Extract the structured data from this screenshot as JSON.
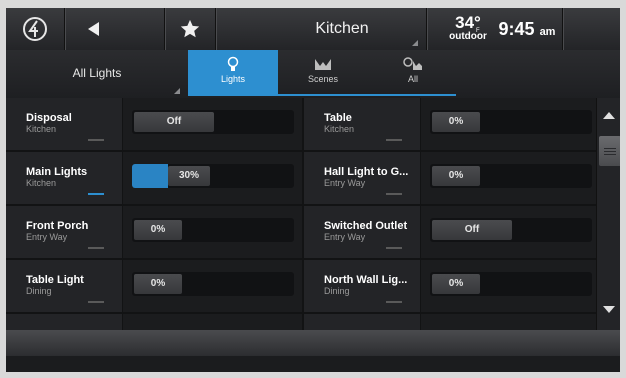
{
  "header": {
    "title": "Kitchen",
    "temperature": "34°",
    "temp_unit": "F",
    "temp_label": "outdoor",
    "time": "9:45",
    "ampm": "am"
  },
  "filter": {
    "label": "All Lights"
  },
  "tabs": [
    {
      "label": "Lights",
      "icon": "bulb-icon",
      "active": true
    },
    {
      "label": "Scenes",
      "icon": "scenes-icon",
      "active": false
    },
    {
      "label": "All",
      "icon": "all-icon",
      "active": false
    }
  ],
  "devices": [
    {
      "name": "Disposal",
      "room": "Kitchen",
      "state": "Off",
      "level": 0
    },
    {
      "name": "Table",
      "room": "Kitchen",
      "state": "0%",
      "level": 0
    },
    {
      "name": "Main Lights",
      "room": "Kitchen",
      "state": "30%",
      "level": 30
    },
    {
      "name": "Hall Light to G...",
      "room": "Entry Way",
      "state": "0%",
      "level": 0
    },
    {
      "name": "Front Porch",
      "room": "Entry Way",
      "state": "0%",
      "level": 0
    },
    {
      "name": "Switched Outlet",
      "room": "Entry Way",
      "state": "Off",
      "level": 0
    },
    {
      "name": "Table Light",
      "room": "Dining",
      "state": "0%",
      "level": 0
    },
    {
      "name": "North Wall Lig...",
      "room": "Dining",
      "state": "0%",
      "level": 0
    }
  ],
  "colors": {
    "accent": "#2d8fd0"
  }
}
